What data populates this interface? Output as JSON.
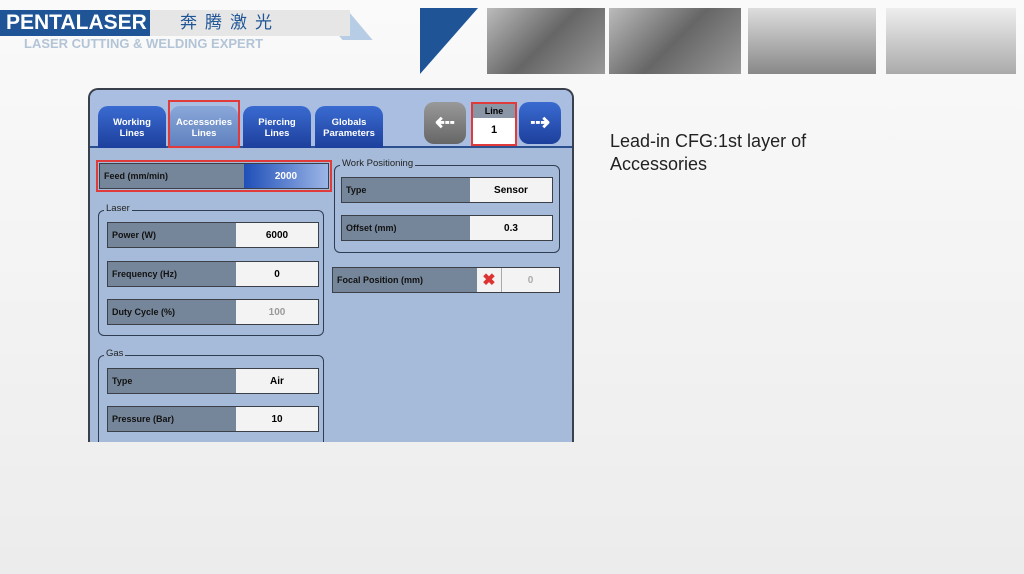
{
  "header": {
    "logo": "PENTALASER",
    "logo_cn": "奔腾激光",
    "slogan": "LASER CUTTING & WELDING EXPERT"
  },
  "tabs": [
    {
      "label1": "Working",
      "label2": "Lines"
    },
    {
      "label1": "Accessories",
      "label2": "Lines"
    },
    {
      "label1": "Piercing",
      "label2": "Lines"
    },
    {
      "label1": "Globals",
      "label2": "Parameters"
    }
  ],
  "line": {
    "label": "Line",
    "value": "1"
  },
  "feed": {
    "label": "Feed (mm/min)",
    "value": "2000"
  },
  "laser": {
    "title": "Laser",
    "power_label": "Power (W)",
    "power": "6000",
    "freq_label": "Frequency (Hz)",
    "freq": "0",
    "duty_label": "Duty Cycle (%)",
    "duty": "100"
  },
  "gas": {
    "title": "Gas",
    "type_label": "Type",
    "type": "Air",
    "pressure_label": "Pressure (Bar)",
    "pressure": "10"
  },
  "work": {
    "title": "Work Positioning",
    "type_label": "Type",
    "type": "Sensor",
    "offset_label": "Offset (mm)",
    "offset": "0.3"
  },
  "focal": {
    "label": "Focal Position (mm)",
    "value": "0"
  },
  "caption": "Lead-in CFG:1st layer of Accessories"
}
